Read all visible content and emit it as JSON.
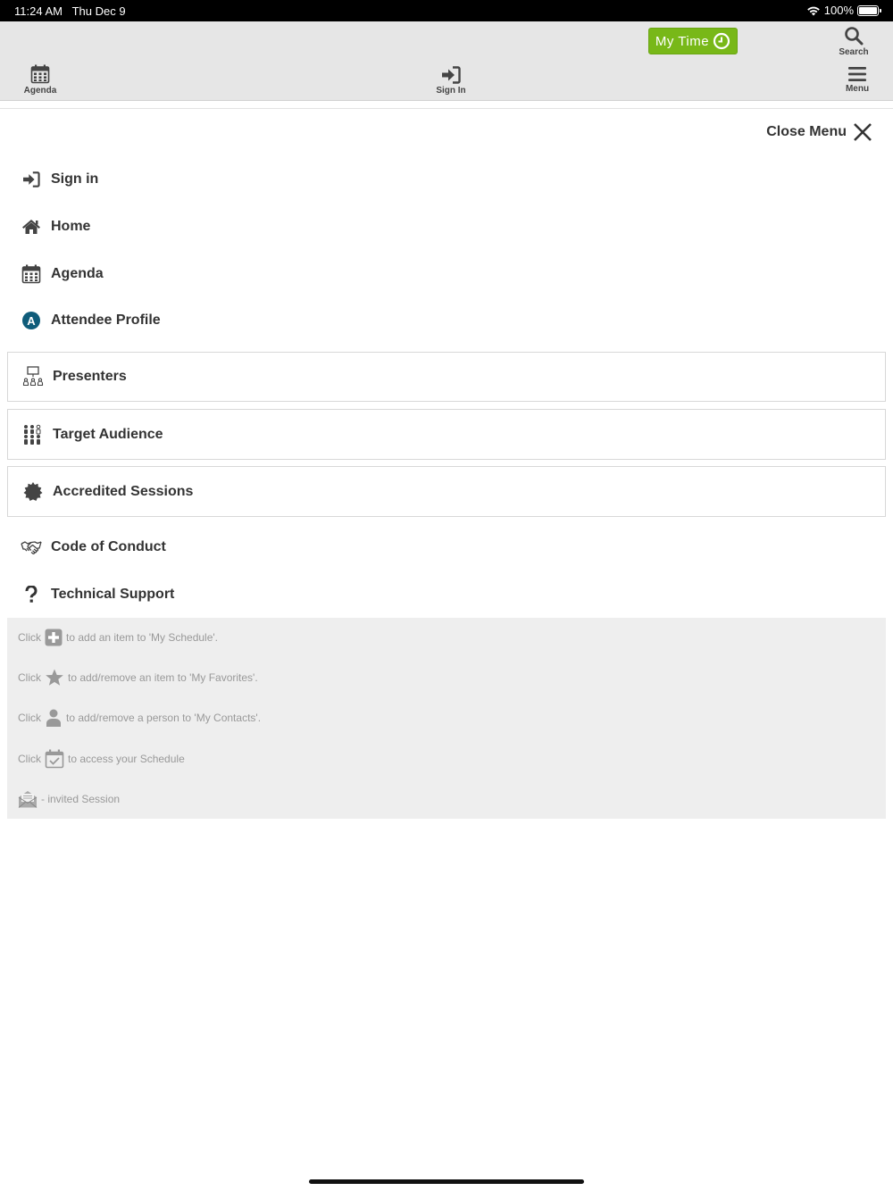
{
  "status_bar": {
    "time": "11:24 AM",
    "date": "Thu Dec 9",
    "battery": "100%"
  },
  "toolbar": {
    "my_time_label": "My Time",
    "search_label": "Search",
    "agenda_label": "Agenda",
    "sign_in_label": "Sign In",
    "menu_label": "Menu",
    "accent_color": "#78b818"
  },
  "menu": {
    "close_label": "Close Menu",
    "items": [
      {
        "label": "Sign in",
        "icon": "sign-in-icon"
      },
      {
        "label": "Home",
        "icon": "home-icon"
      },
      {
        "label": "Agenda",
        "icon": "calendar-icon"
      },
      {
        "label": "Attendee Profile",
        "icon": "attendee-profile-icon",
        "icon_text": "A"
      },
      {
        "label": "Presenters",
        "icon": "presenters-icon"
      },
      {
        "label": "Target Audience",
        "icon": "audience-icon"
      },
      {
        "label": "Accredited Sessions",
        "icon": "badge-icon"
      },
      {
        "label": "Code of Conduct",
        "icon": "handshake-icon"
      },
      {
        "label": "Technical Support",
        "icon": "question-icon"
      }
    ]
  },
  "legend": {
    "click_word": "Click",
    "rows": [
      {
        "text": "to add an item to 'My Schedule'.",
        "icon": "plus-icon"
      },
      {
        "text": "to add/remove an item to 'My Favorites'.",
        "icon": "star-icon"
      },
      {
        "text": "to add/remove a person to 'My Contacts'.",
        "icon": "person-icon"
      },
      {
        "text": "to access your Schedule",
        "icon": "calendar-check-icon"
      },
      {
        "text": "- invited Session",
        "icon": "envelope-icon"
      }
    ]
  }
}
